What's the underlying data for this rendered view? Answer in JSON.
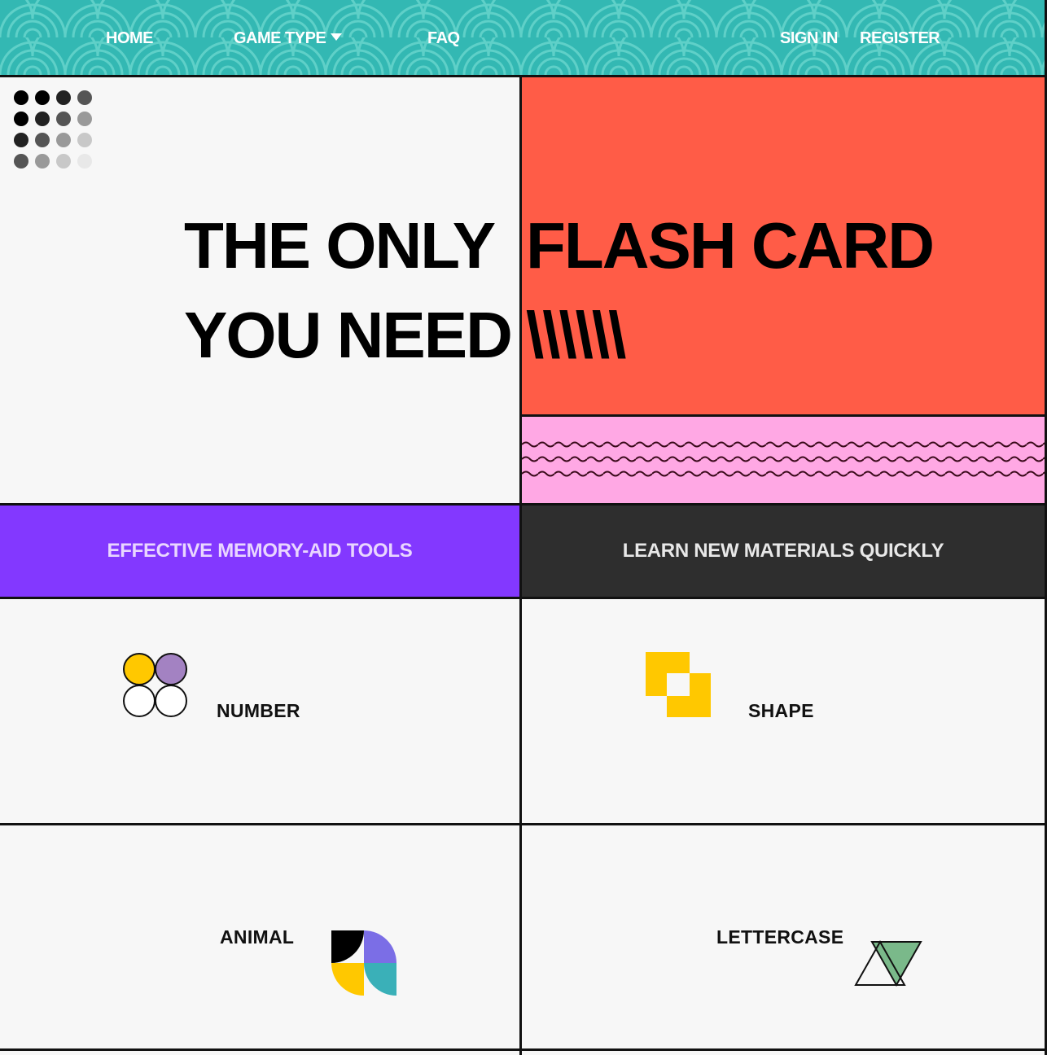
{
  "nav": {
    "home": "HOME",
    "game_type": "GAME TYPE",
    "faq": "FAQ",
    "sign_in": "SIGN IN",
    "register": "REGISTER"
  },
  "hero": {
    "line1_left": "THE ONLY",
    "line1_right": "FLASH CARD",
    "line2_left": "YOU NEED",
    "line2_right": "\\\\\\\\\\\\"
  },
  "banners": {
    "left": "EFFECTIVE MEMORY-AID TOOLS",
    "right": "LEARN NEW MATERIALS QUICKLY"
  },
  "cards": {
    "number": "NUMBER",
    "shape": "SHAPE",
    "animal": "ANIMAL",
    "lettercase": "LETTERCASE"
  },
  "colors": {
    "nav_bg": "#33b8b3",
    "hero_red": "#ff5c47",
    "hero_pink": "#ffa8e4",
    "banner_purple": "#8338ff",
    "banner_dark": "#2e2e2e",
    "accent_yellow": "#ffc800",
    "accent_lavender": "#7b6ee6",
    "accent_teal": "#3ab0b8",
    "accent_green": "#7ab98a"
  },
  "icons": {
    "dots": "dot-grid-icon",
    "number": "four-circles-icon",
    "shape": "yellow-squares-icon",
    "animal": "quarter-shapes-icon",
    "lettercase": "triangles-icon"
  }
}
